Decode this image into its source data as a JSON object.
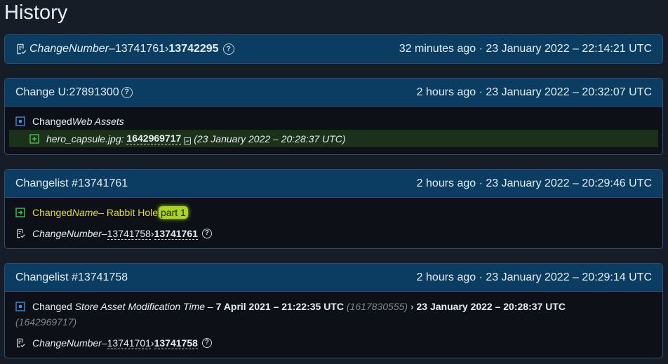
{
  "page": {
    "title": "History"
  },
  "cards": [
    {
      "header_left": {
        "field": "ChangeNumber",
        "sep": " – ",
        "old": "13741761",
        "arrow": " › ",
        "new": "13742295"
      },
      "header_right": "32 minutes ago · 23 January 2022 – 22:14:21 UTC"
    },
    {
      "header_left": "Change U:27891300",
      "header_right": "2 hours ago · 23 January 2022 – 20:32:07 UTC",
      "rows": [
        {
          "prefix": "Changed ",
          "field": "Web Assets"
        },
        {
          "file": "hero_capsule.jpg:",
          "value": "1642969717",
          "date": "(23 January 2022 – 20:28:37 UTC)"
        }
      ]
    },
    {
      "header_left": "Changelist #13741761",
      "header_right": "2 hours ago · 23 January 2022 – 20:29:46 UTC",
      "rows": [
        {
          "prefix": "Changed ",
          "field": "Name",
          "sep": " – Rabbit Hole",
          "pill": "part 1"
        },
        {
          "field": "ChangeNumber",
          "sep": " – ",
          "old": "13741758",
          "arrow": " › ",
          "new": "13741761"
        }
      ]
    },
    {
      "header_left": "Changelist #13741758",
      "header_right": "2 hours ago · 23 January 2022 – 20:29:14 UTC",
      "rows": [
        {
          "prefix": "Changed ",
          "field": "Store Asset Modification Time",
          "sep": " – ",
          "old": "7 April 2021 – 21:22:35 UTC",
          "old_raw": "(1617830555)",
          "arrow": " › ",
          "new": "23 January 2022 – 20:28:37 UTC",
          "new_raw": "(1642969717)"
        },
        {
          "field": "ChangeNumber",
          "sep": " – ",
          "old": "13741701",
          "arrow": " › ",
          "new": "13741758"
        }
      ]
    }
  ],
  "help_glyph": "?",
  "colors": {
    "header_bg": "#0b3d63",
    "added_bg": "#1c3119",
    "highlight": "#a7d61d",
    "accent": "#3a8fd9"
  },
  "icons": [
    "changelist-icon",
    "modified-square-icon",
    "added-square-icon",
    "renamed-arrow-icon",
    "external-link-icon",
    "help-icon"
  ]
}
